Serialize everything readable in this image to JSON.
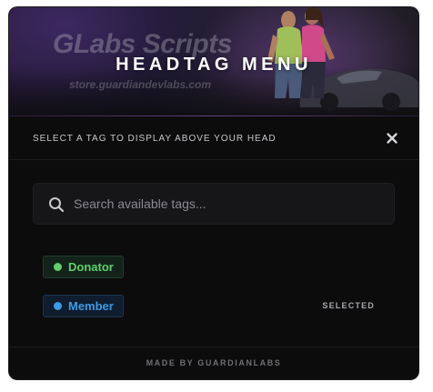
{
  "header": {
    "title": "HEADTAG MENU",
    "watermark_logo": "GLabs Scripts",
    "watermark_url": "store.guardiandevlabs.com"
  },
  "subheader": {
    "instruction": "SELECT A TAG TO DISPLAY ABOVE YOUR HEAD",
    "close_icon": "close-icon"
  },
  "search": {
    "placeholder": "Search available tags...",
    "value": "",
    "icon": "search-icon"
  },
  "tags": [
    {
      "label": "Donator",
      "color": "#5fd06c",
      "status": ""
    },
    {
      "label": "Member",
      "color": "#3d9be6",
      "status": "SELECTED"
    }
  ],
  "footer": {
    "credit": "MADE BY GUARDIANLABS"
  },
  "colors": {
    "panel_bg": "#0c0c0d",
    "accent": "#9a6ee0"
  }
}
